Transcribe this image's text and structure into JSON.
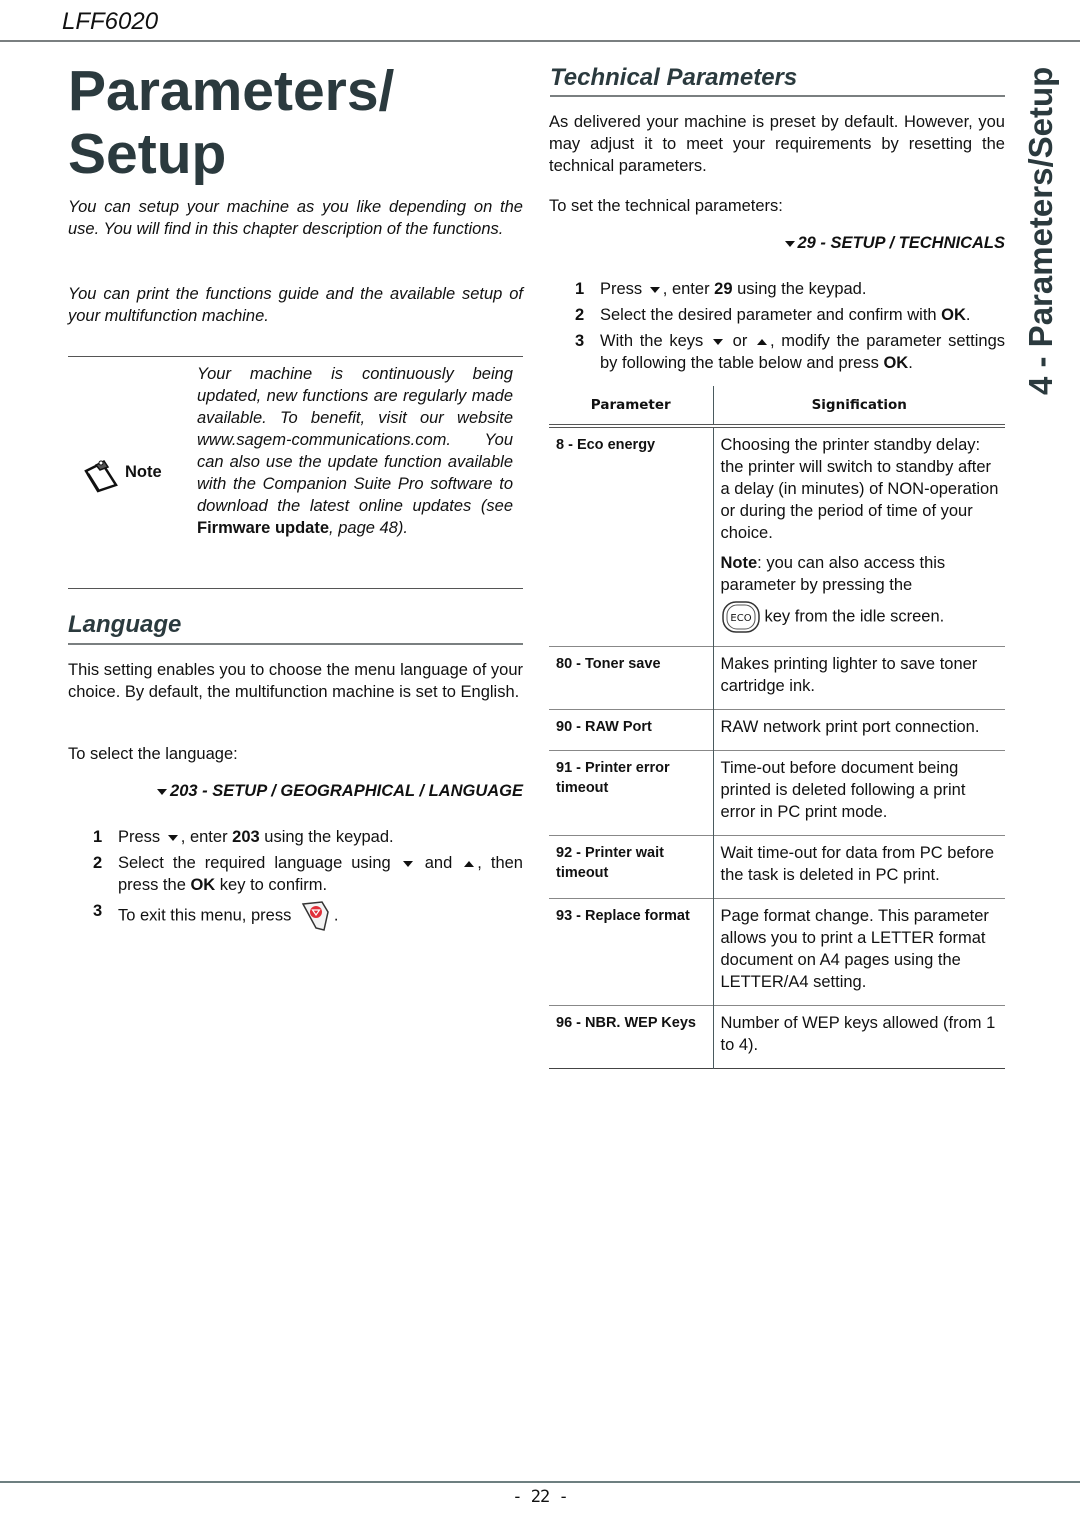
{
  "header": {
    "model": "LFF6020"
  },
  "page": {
    "title_line1": "Parameters/",
    "title_line2": "Setup",
    "side_tab": "4 - Parameters/Setup",
    "page_number": "- 22 -"
  },
  "intro": {
    "p1": "You can setup your machine as you like depending on the use. You will find in this chapter description of the functions.",
    "p2": "You can print the functions guide and the available setup of your multifunction machine."
  },
  "note": {
    "label": "Note",
    "text_before": "Your machine is continuously being updated, new functions are regularly made available. To benefit, visit our website www.sagem-communications.com. You can also use the update function available with the Companion Suite Pro software to download the latest online updates (see ",
    "link": "Firmware update",
    "text_after": ", page 48)."
  },
  "language": {
    "title": "Language",
    "p1": "This setting enables you to choose the menu language of your choice. By default, the multifunction machine is set to English.",
    "p2": "To select the language:",
    "menu_path": "203 - SETUP / GEOGRAPHICAL / LANGUAGE",
    "steps": [
      {
        "num": "1",
        "a": "Press",
        "b": ", enter ",
        "bold": "203",
        "c": " using the keypad."
      },
      {
        "num": "2",
        "a": "Select the required language using",
        "b": " and ",
        "c": ", then press the ",
        "bold": "OK",
        "d": " key to confirm."
      },
      {
        "num": "3",
        "a": "To exit this menu, press",
        "b": "."
      }
    ]
  },
  "technical": {
    "title": "Technical Parameters",
    "p1": "As delivered your machine is preset by default. However, you may adjust it to meet your requirements by resetting the technical parameters.",
    "p2": "To set the technical parameters:",
    "menu_path": "29 - SETUP / TECHNICALS",
    "steps": [
      {
        "num": "1",
        "a": "Press",
        "b": ", enter ",
        "bold": "29",
        "c": " using the keypad."
      },
      {
        "num": "2",
        "a": "Select the desired parameter and confirm with ",
        "bold": "OK",
        "b": "."
      },
      {
        "num": "3",
        "a": "With the keys",
        "b": " or ",
        "c": ", modify the parameter settings by following the table below and press ",
        "bold": "OK",
        "d": "."
      }
    ],
    "table": {
      "headers": [
        "Parameter",
        "Signification"
      ],
      "rows": [
        {
          "param": "8 - Eco energy",
          "desc": "Choosing the printer standby delay: the printer will switch to standby after a delay (in minutes) of NON-operation or during the period of time of your choice.",
          "note_bold": "Note",
          "note_text": ": you can also access this parameter by pressing the",
          "key_label": "ECO",
          "note_after": "key from the idle screen."
        },
        {
          "param": "80 - Toner save",
          "desc": "Makes printing lighter to save toner cartridge ink."
        },
        {
          "param": "90 - RAW Port",
          "desc": "RAW network print port connection."
        },
        {
          "param": "91 - Printer error timeout",
          "desc": "Time-out before document being printed is deleted following a print error in PC print mode."
        },
        {
          "param": "92 - Printer wait timeout",
          "desc": "Wait time-out for data from PC before the task is deleted in PC print."
        },
        {
          "param": "93 - Replace format",
          "desc": "Page format change. This parameter allows you to print a LETTER format document on A4 pages using the LETTER/A4 setting."
        },
        {
          "param": "96 - NBR. WEP Keys",
          "desc": "Number of WEP keys allowed (from 1 to 4)."
        }
      ]
    }
  },
  "colors": {
    "heading": "#2b3a3e",
    "rule": "#7a7f80",
    "stop_key_red": "#e0303a"
  }
}
